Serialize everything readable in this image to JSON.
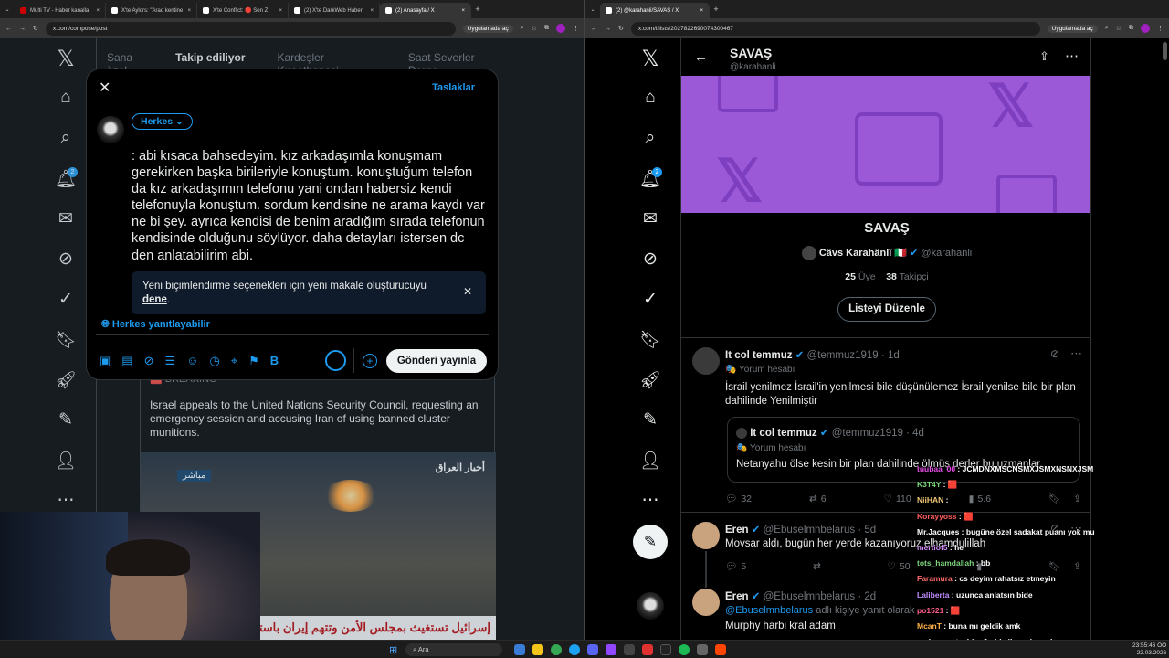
{
  "left_window": {
    "tabs": [
      "Multi TV - Haber kanalla",
      "X'te Aylors: \"Arad kentine",
      "X'te Conflict: 🔴 Son Z",
      "(2) X'te DarkWeb Haber",
      "(2) Anasayfa / X"
    ],
    "url": "x.com/compose/post",
    "app_pill": "Uygulamada aç",
    "feed_tabs": [
      "Sana özel",
      "Takip ediliyor",
      "Kardeşler Kıraathanesi",
      "Saat Severler Derne"
    ],
    "composer": {
      "drafts": "Taslaklar",
      "audience": "Herkes",
      "text": ": abi kısaca bahsedeyim. kız arkadaşımla konuşmam gerekirken başka birileriyle konuştum. konuştuğum telefon da kız arkadaşımın telefonu yani ondan habersiz kendi telefonuyla konuştum. sordum kendisine ne arama kaydı var ne bi şey. ayrıca kendisi de benim aradığım sırada telefonun kendisinde olduğunu söylüyor. daha detayları istersen dc den anlatabilirim abi.",
      "info_text": "Yeni biçimlendirme seçenekleri için yeni makale oluşturucuyu",
      "info_link": "dene",
      "reply_setting": "Herkes yanıtlayabilir",
      "post_button": "Gönderi yayınla"
    },
    "post": {
      "tag": "BREAKING",
      "text": "Israel appeals to the United Nations Security Council, requesting an emergency session and accusing Iran of using banned cluster munitions.",
      "video_logo": "أخبار العراق",
      "video_live": "مباشر",
      "video_ticker": "إسرائيل تستغيث بمجلس الأمن وتتهم إيران باستخ"
    }
  },
  "right_window": {
    "tab": "(2) @karahanli/SAVAŞ / X",
    "url": "x.com/i/lists/2027822690074300467",
    "app_pill": "Uygulamada aç",
    "header": {
      "title": "SAVAŞ",
      "handle": "@karahanli"
    },
    "list": {
      "name": "SAVAŞ",
      "owner_name": "Câvs Karahânlî 🇮🇹",
      "owner_handle": "@karahanli",
      "members_count": "25",
      "members_label": "Üye",
      "followers_count": "38",
      "followers_label": "Takipçi",
      "edit_button": "Listeyi Düzenle"
    },
    "tweets": [
      {
        "name": "It col temmuz",
        "handle": "@temmuz1919",
        "time": "1d",
        "sub": "🎭 Yorum hesabı",
        "text": "İsrail yenilmez İsrail'in yenilmesi bile düşünülemez İsrail yenilse bile bir plan dahilinde Yenilmiştir",
        "quote": {
          "name": "It col temmuz",
          "handle": "@temmuz1919",
          "time": "4d",
          "sub": "🎭 Yorum hesabı",
          "text": "Netanyahu ölse kesin bir plan dahilinde ölmüş derler bu uzmanlar."
        },
        "replies": "32",
        "reposts": "6",
        "likes": "110",
        "views": "5.6"
      },
      {
        "name": "Eren",
        "handle": "@Ebuselmnbelarus",
        "time": "5d",
        "text": "Movsar aldı, bugün her yerde kazanıyoruz elhamdulillah",
        "replies": "5",
        "likes": "50"
      },
      {
        "name": "Eren",
        "handle": "@Ebuselmnbelarus",
        "time": "2d",
        "reply_to_handle": "@Ebuselmnbelarus",
        "reply_to_suffix": "adlı kişiye yanıt olarak",
        "text": "Murphy harbi kral adam"
      }
    ],
    "notif_badge": "2"
  },
  "chat": [
    {
      "user": "tuubaa_00",
      "msg": "JCMDNXMSCNSMXJSMXNSNXJSM",
      "color": "#e64ce6"
    },
    {
      "user": "K3T4Y",
      "msg": "🟥",
      "color": "#7cd67c"
    },
    {
      "user": "NiiHAN",
      "msg": "",
      "color": "#f0c674"
    },
    {
      "user": "Korayyoss",
      "msg": "🟥",
      "color": "#ff5c5c"
    },
    {
      "user": "Mr.Jacques",
      "msg": "bugüne özel sadakat puanı yok mu",
      "color": "#ffffff"
    },
    {
      "user": "mertiof5",
      "msg": "he",
      "color": "#d68cff"
    },
    {
      "user": "tots_hamdallah",
      "msg": "bb",
      "color": "#7cd67c"
    },
    {
      "user": "Faramura",
      "msg": "cs deyim rahatsız etmeyin",
      "color": "#ff6b6b"
    },
    {
      "user": "Laliberta",
      "msg": "uzunca anlatsın bide",
      "color": "#c28cff"
    },
    {
      "user": "po1521",
      "msg": "🟥",
      "color": "#ff5c8a"
    },
    {
      "user": "McanT",
      "msg": "buna mı geldik amk",
      "color": "#ffb347"
    },
    {
      "user": "muhammetsahinn0",
      "msg": "bi sik anşlamadım",
      "color": "#ffffff"
    }
  ],
  "taskbar": {
    "search": "Ara",
    "time": "23:55:46 ÖÖ",
    "date": "22.03.2026"
  }
}
